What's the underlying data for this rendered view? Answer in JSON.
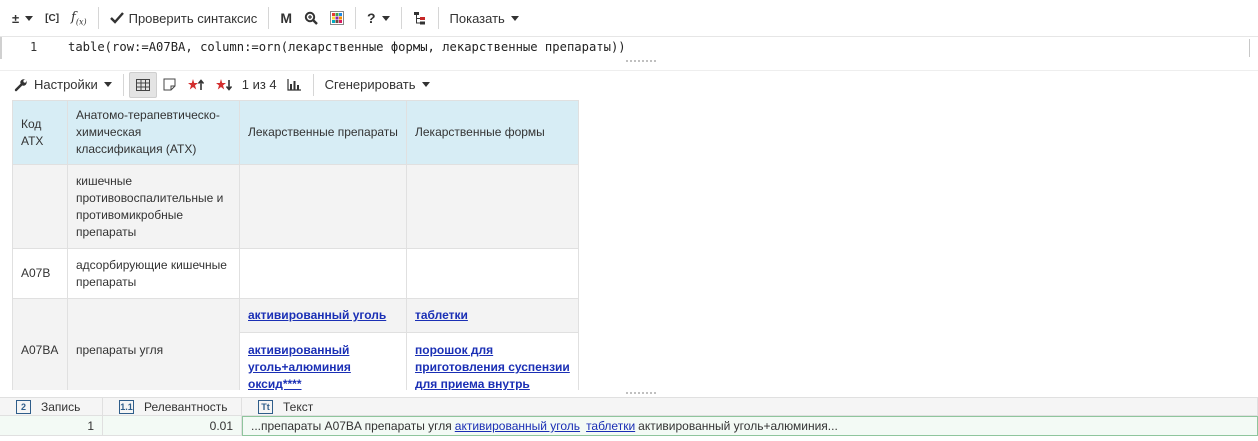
{
  "toolbar": {
    "plusminus": "±",
    "brackets": "[C]",
    "fx_main": "f",
    "fx_sub": "(x)",
    "check_syntax": "Проверить синтаксис",
    "m_label": "M",
    "help_label": "?",
    "show_label": "Показать"
  },
  "editor": {
    "line_number": "1",
    "code": "table(row:=A07BA, column:=orn(лекарственные формы, лекарственные препараты))"
  },
  "toolbar2": {
    "settings": "Настройки",
    "pager": "1 из 4",
    "generate": "Сгенерировать"
  },
  "table": {
    "headers": {
      "code": "Код АТХ",
      "classification": "Анатомо-терапевтическо-химическая классификация (АТХ)",
      "drugs": "Лекарственные препараты",
      "forms": "Лекарственные формы"
    },
    "rows": [
      {
        "code": "",
        "name": "кишечные противовоспалительные и противомикробные препараты"
      },
      {
        "code": "A07B",
        "name": "адсорбирующие кишечные препараты"
      },
      {
        "code": "A07BA",
        "name": "препараты угля",
        "items": [
          {
            "drug": "активированный уголь",
            "form": "таблетки"
          },
          {
            "drug": "активированный уголь+алюминия оксид****",
            "form": "порошок для приготовления суспензии для приема внутрь"
          }
        ]
      }
    ]
  },
  "results": {
    "columns": {
      "record_icon": "2",
      "record": "Запись",
      "relevance_icon": "1.1",
      "relevance": "Релевантность",
      "text_icon": "Tt",
      "text": "Текст"
    },
    "row": {
      "record": "1",
      "relevance": "0.01",
      "text_prefix": "...препараты A07BA препараты угля",
      "link1": "активированный уголь",
      "link2": "таблетки",
      "text_suffix": "активированный уголь+алюминия..."
    }
  },
  "colors": {
    "header_bg": "#d7edf5",
    "link": "#1a2fb5",
    "result_border": "#8fc59d",
    "icon_border": "#2f5d8a"
  }
}
